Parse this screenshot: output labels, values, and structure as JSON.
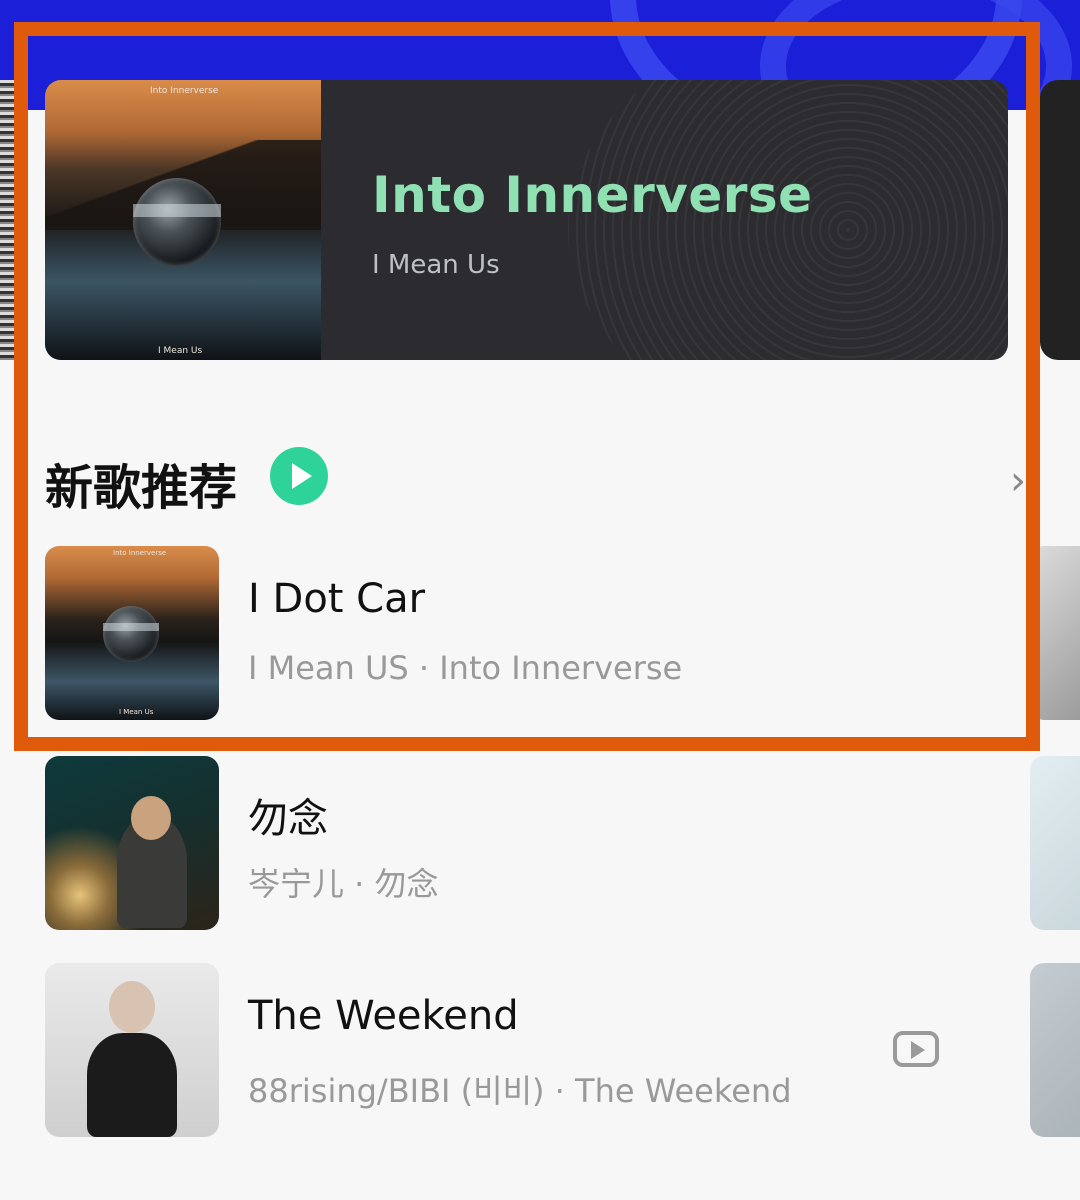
{
  "banner": {
    "title": "Into Innerverse",
    "artist": "I Mean Us",
    "art_caption_top": "Into Innerverse",
    "art_caption_bottom": "I Mean Us"
  },
  "section": {
    "title": "新歌推荐",
    "play_icon": "play-circle-icon",
    "more_icon": "chevron-right-icon"
  },
  "songs": [
    {
      "title": "I Dot Car",
      "subtitle": "I Mean US · Into Innerverse",
      "cover_caption_top": "Into Innerverse",
      "cover_caption_bottom": "I Mean Us"
    },
    {
      "title": "勿念",
      "subtitle": "岑宁儿 · 勿念"
    },
    {
      "title": "The Weekend",
      "subtitle": "88rising/BIBI (비비) · The Weekend",
      "action_icon": "mv-play-icon"
    }
  ],
  "colors": {
    "accent_green": "#2ed39a",
    "banner_title": "#8fe0b2",
    "highlight_frame": "#e05a0c",
    "top_band": "#1c1fd8"
  }
}
